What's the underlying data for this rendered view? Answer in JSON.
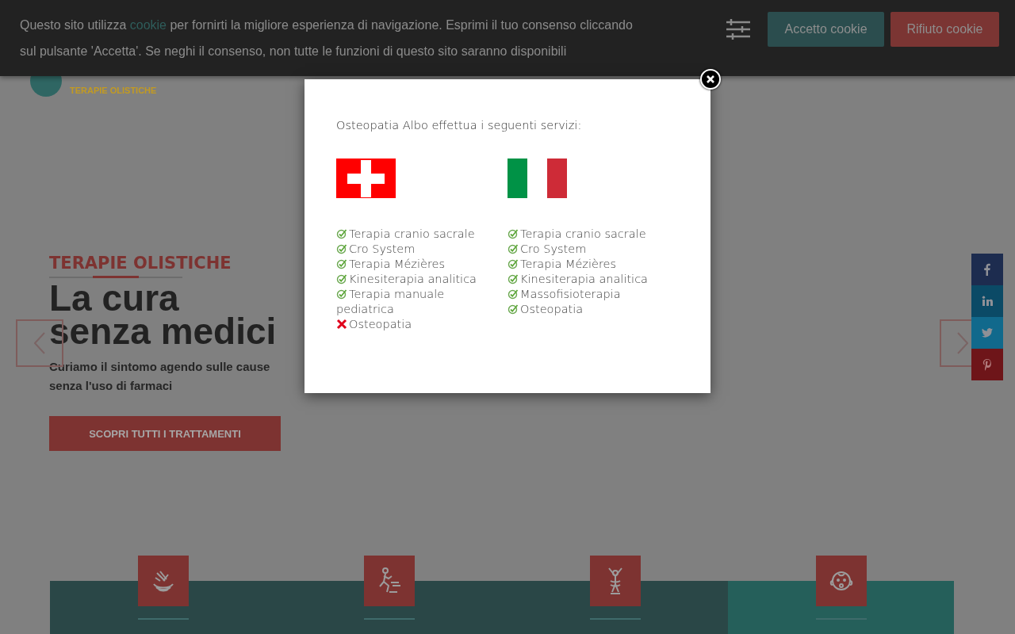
{
  "header": {
    "logo_subtitle": "TERAPIE OLISTICHE"
  },
  "cookie_banner": {
    "text_before": "Questo sito utilizza ",
    "link": "cookie",
    "text_after": " per fornirti la migliore esperienza di navigazione. Esprimi il tuo consenso cliccando sul pulsante 'Accetta'. Se neghi il consenso, non tutte le funzioni di questo sito saranno disponibili",
    "buttons": [
      {
        "label": "Accetto cookie",
        "kind": "accept"
      },
      {
        "label": "Rifiuto cookie",
        "kind": "reject"
      }
    ]
  },
  "hero": {
    "eyebrow": "TERAPIE OLISTICHE",
    "title_lines": [
      "La cura",
      "senza medici"
    ],
    "subtitle_lines": [
      "Curiamo il sintomo agendo sulle cause",
      "senza l'uso di farmaci"
    ],
    "button": "SCOPRI TUTTI I TRATTAMENTI"
  },
  "modal": {
    "intro": "Osteopatia Albo effettua i seguenti servizi:",
    "columns": [
      {
        "kind": "switzerland",
        "items": [
          {
            "label": "Terapia cranio sacrale",
            "available": true
          },
          {
            "label": "Cro System",
            "available": true
          },
          {
            "label": "Terapia Mézières",
            "available": true
          },
          {
            "label": "Kinesiterapia analitica",
            "available": true
          },
          {
            "label": "Terapia manuale pediatrica",
            "available": true
          },
          {
            "label": "Osteopatia",
            "available": false
          }
        ]
      },
      {
        "kind": "italy",
        "items": [
          {
            "label": "Terapia cranio sacrale",
            "available": true
          },
          {
            "label": "Cro System",
            "available": true
          },
          {
            "label": "Terapia Mézières",
            "available": true
          },
          {
            "label": "Kinesiterapia analitica",
            "available": true
          },
          {
            "label": "Massofisioterapia",
            "available": true
          },
          {
            "label": "Osteopatia",
            "available": true
          }
        ]
      }
    ]
  },
  "social": [
    {
      "kind": "facebook"
    },
    {
      "kind": "linkedin"
    },
    {
      "kind": "twitter"
    },
    {
      "kind": "pinterest"
    }
  ],
  "service_cards": [
    {
      "kind": "hands",
      "selected": false
    },
    {
      "kind": "runner",
      "selected": false
    },
    {
      "kind": "figure",
      "selected": false
    },
    {
      "kind": "baby",
      "selected": true
    }
  ]
}
